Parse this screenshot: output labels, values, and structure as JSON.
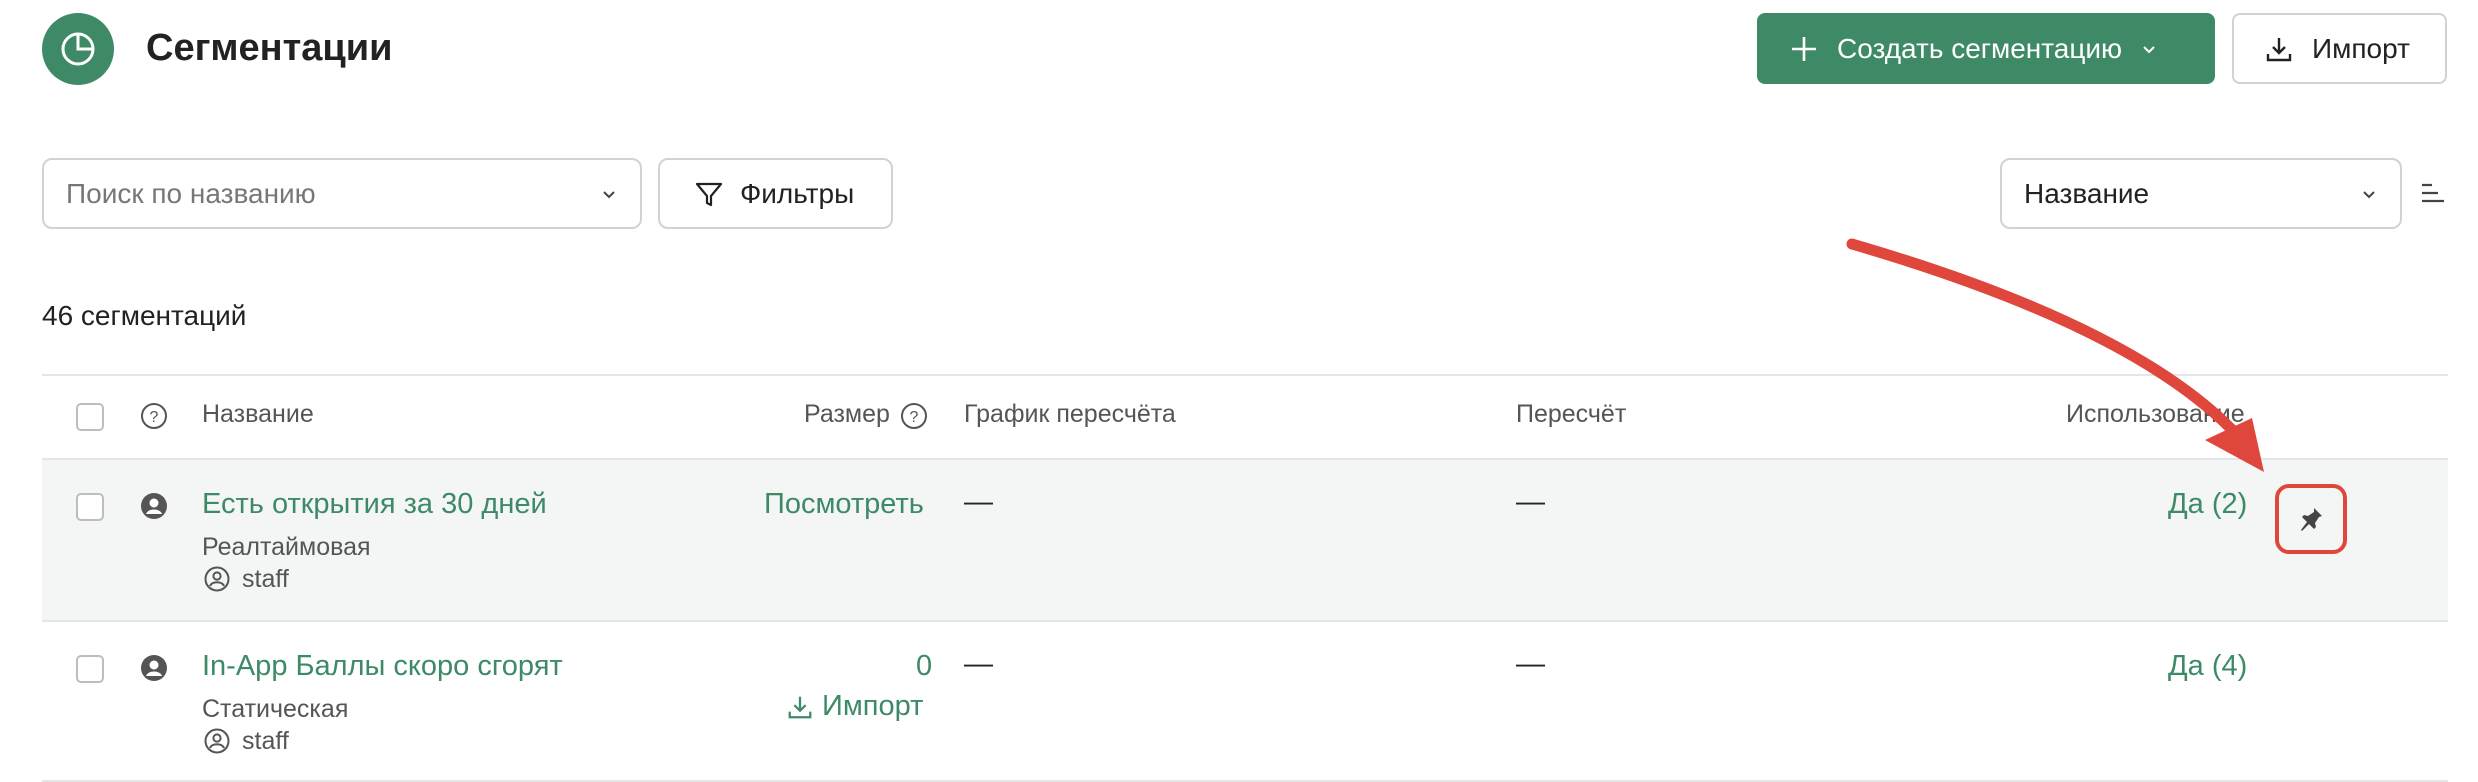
{
  "header": {
    "title": "Сегментации",
    "create_label": "Создать сегментацию",
    "import_label": "Импорт"
  },
  "toolbar": {
    "search_placeholder": "Поиск по названию",
    "filters_label": "Фильтры",
    "sort_value": "Название"
  },
  "summary": {
    "count_text": "46 сегментаций"
  },
  "table": {
    "columns": {
      "name": "Название",
      "size": "Размер",
      "schedule": "График пересчёта",
      "recalc": "Пересчёт",
      "usage": "Использование"
    },
    "rows": [
      {
        "name": "Есть открытия за 30 дней",
        "type": "Реалтаймовая",
        "owner": "staff",
        "size": "Посмотреть",
        "schedule": "—",
        "recalc": "—",
        "usage": "Да (2)"
      },
      {
        "name": "In-App Баллы скоро сгорят",
        "type": "Статическая",
        "owner": "staff",
        "size": "0",
        "size_action": "Импорт",
        "schedule": "—",
        "recalc": "—",
        "usage": "Да (4)"
      }
    ]
  },
  "colors": {
    "accent": "#3e8a67",
    "highlight_row": "#f3f6f5",
    "annotation": "#e0473c"
  },
  "icons": {
    "logo": "pie-chart-icon",
    "create": "plus-icon",
    "import": "download-icon",
    "filters": "funnel-icon",
    "help": "question-icon",
    "pin": "pin-icon",
    "user": "user-icon",
    "owner": "user-circle-icon"
  }
}
